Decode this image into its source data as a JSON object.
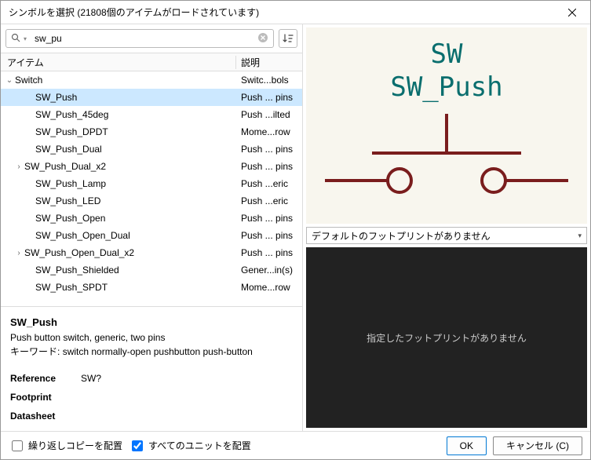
{
  "window": {
    "title": "シンボルを選択 (21808個のアイテムがロードされています)"
  },
  "search": {
    "value": "sw_pu"
  },
  "columns": {
    "item": "アイテム",
    "desc": "説明"
  },
  "tree": {
    "group_icon_open": "⌄",
    "group_icon_closed": "›",
    "items": [
      {
        "indent": 0,
        "expander": "open",
        "label": "Switch",
        "desc": "Switc...bols",
        "selected": false
      },
      {
        "indent": 1,
        "expander": "",
        "label": "SW_Push",
        "desc": "Push ... pins",
        "selected": true
      },
      {
        "indent": 1,
        "expander": "",
        "label": "SW_Push_45deg",
        "desc": "Push ...ilted",
        "selected": false
      },
      {
        "indent": 1,
        "expander": "",
        "label": "SW_Push_DPDT",
        "desc": "Mome...row",
        "selected": false
      },
      {
        "indent": 1,
        "expander": "",
        "label": "SW_Push_Dual",
        "desc": "Push ... pins",
        "selected": false
      },
      {
        "indent": 1,
        "expander": "closed",
        "label": "SW_Push_Dual_x2",
        "desc": "Push ... pins",
        "selected": false
      },
      {
        "indent": 1,
        "expander": "",
        "label": "SW_Push_Lamp",
        "desc": "Push ...eric",
        "selected": false
      },
      {
        "indent": 1,
        "expander": "",
        "label": "SW_Push_LED",
        "desc": "Push ...eric",
        "selected": false
      },
      {
        "indent": 1,
        "expander": "",
        "label": "SW_Push_Open",
        "desc": "Push ... pins",
        "selected": false
      },
      {
        "indent": 1,
        "expander": "",
        "label": "SW_Push_Open_Dual",
        "desc": "Push ... pins",
        "selected": false
      },
      {
        "indent": 1,
        "expander": "closed",
        "label": "SW_Push_Open_Dual_x2",
        "desc": "Push ... pins",
        "selected": false
      },
      {
        "indent": 1,
        "expander": "",
        "label": "SW_Push_Shielded",
        "desc": "Gener...in(s)",
        "selected": false
      },
      {
        "indent": 1,
        "expander": "",
        "label": "SW_Push_SPDT",
        "desc": "Mome...row",
        "selected": false
      }
    ]
  },
  "details": {
    "name": "SW_Push",
    "desc": "Push button switch, generic, two pins",
    "keywords_label": "キーワード:",
    "keywords": "switch normally-open pushbutton push-button",
    "props": [
      {
        "label": "Reference",
        "value": "SW?"
      },
      {
        "label": "Footprint",
        "value": ""
      },
      {
        "label": "Datasheet",
        "value": ""
      }
    ]
  },
  "preview": {
    "ref": "SW",
    "name": "SW_Push"
  },
  "footprint": {
    "dropdown": "デフォルトのフットプリントがありません",
    "empty": "指定したフットプリントがありません"
  },
  "footer": {
    "repeat": "繰り返しコピーを配置",
    "repeat_checked": false,
    "allunits": "すべてのユニットを配置",
    "allunits_checked": true,
    "ok": "OK",
    "cancel": "キャンセル (C)"
  }
}
